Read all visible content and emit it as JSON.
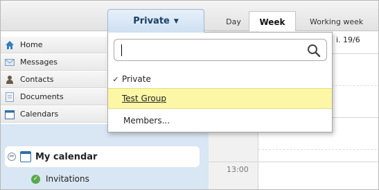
{
  "header": {
    "private_tab": {
      "label": "Private",
      "caret": "▼"
    }
  },
  "sidebar": {
    "items": [
      {
        "label": "Home",
        "icon": "home-icon"
      },
      {
        "label": "Messages",
        "icon": "messages-icon"
      },
      {
        "label": "Contacts",
        "icon": "contacts-icon"
      },
      {
        "label": "Documents",
        "icon": "documents-icon"
      },
      {
        "label": "Calendars",
        "icon": "calendars-icon"
      }
    ],
    "my_calendar": {
      "label": "My calendar",
      "toggle": "−"
    },
    "invitations": {
      "label": "Invitations"
    }
  },
  "calendar": {
    "view_tabs": [
      "Day",
      "Week",
      "Working week"
    ],
    "active_view": "Week",
    "date_header": "i. 19/6",
    "time_label": "13:00"
  },
  "dropdown": {
    "search": {
      "value": "",
      "placeholder": ""
    },
    "items": [
      {
        "label": "Private",
        "checked": true
      },
      {
        "label": "Test Group",
        "highlighted": true
      },
      {
        "label": "Members..."
      }
    ]
  },
  "colors": {
    "accent_blue": "#1a3f66",
    "highlight_yellow": "#fbf7a6",
    "sidebar_section": "#d9e6f3"
  }
}
